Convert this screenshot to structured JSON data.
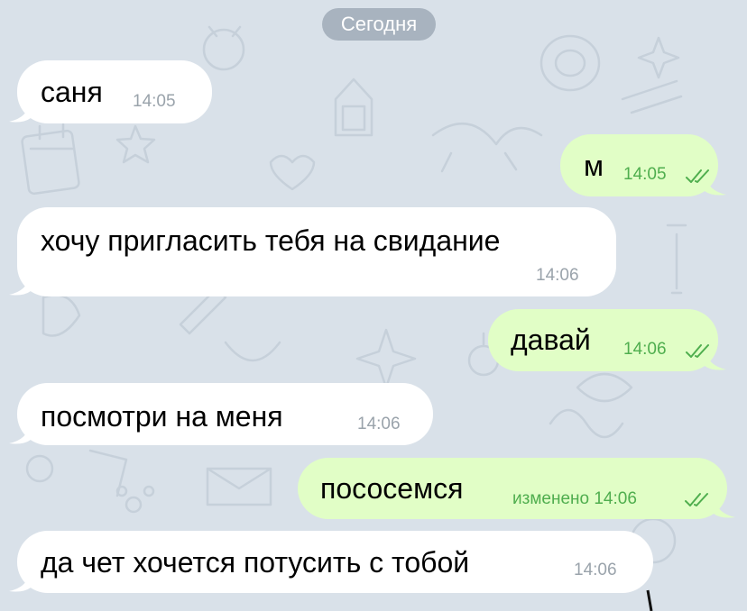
{
  "chat": {
    "date_separator": "Сегодня",
    "colors": {
      "background": "#d9e1e9",
      "incoming_bubble": "#ffffff",
      "outgoing_bubble": "#e1fec6",
      "outgoing_time": "#4fae4e",
      "incoming_time": "#9aa3ab"
    },
    "messages": [
      {
        "direction": "incoming",
        "text": "саня",
        "time": "14:05"
      },
      {
        "direction": "outgoing",
        "text": "м",
        "time": "14:05",
        "status": "read-double-check-icon"
      },
      {
        "direction": "incoming",
        "text": "хочу пригласить тебя на свидание",
        "time": "14:06"
      },
      {
        "direction": "outgoing",
        "text": "давай",
        "time": "14:06",
        "status": "read-double-check-icon"
      },
      {
        "direction": "incoming",
        "text": "посмотри на меня",
        "time": "14:06"
      },
      {
        "direction": "outgoing",
        "text": "пососемся",
        "time": "изменено 14:06",
        "status": "read-double-check-icon"
      },
      {
        "direction": "incoming",
        "text": "да чет хочется потусить с тобой",
        "time": "14:06"
      }
    ]
  }
}
